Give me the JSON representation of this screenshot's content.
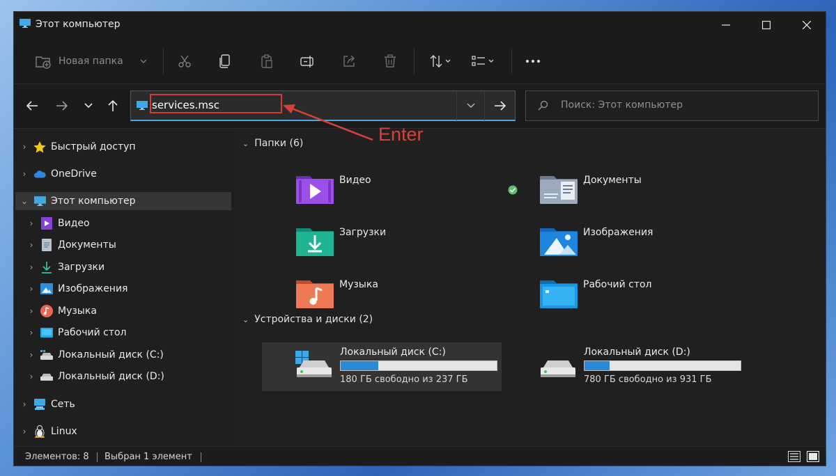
{
  "window": {
    "title": "Этот компьютер"
  },
  "toolbar": {
    "new_folder_label": "Новая папка"
  },
  "address": {
    "value": "services.msc",
    "annotation": "Enter"
  },
  "search": {
    "placeholder": "Поиск: Этот компьютер"
  },
  "sidebar": {
    "items": [
      {
        "label": "Быстрый доступ",
        "icon": "star-icon",
        "level": 0
      },
      {
        "label": "OneDrive",
        "icon": "cloud-icon",
        "level": 0
      },
      {
        "label": "Этот компьютер",
        "icon": "computer-icon",
        "level": 0,
        "expanded": true,
        "selected": true
      },
      {
        "label": "Видео",
        "icon": "video-icon",
        "level": 1
      },
      {
        "label": "Документы",
        "icon": "documents-icon",
        "level": 1
      },
      {
        "label": "Загрузки",
        "icon": "downloads-icon",
        "level": 1
      },
      {
        "label": "Изображения",
        "icon": "pictures-icon",
        "level": 1
      },
      {
        "label": "Музыка",
        "icon": "music-icon",
        "level": 1
      },
      {
        "label": "Рабочий стол",
        "icon": "desktop-icon",
        "level": 1
      },
      {
        "label": "Локальный диск (C:)",
        "icon": "drive-icon",
        "level": 1
      },
      {
        "label": "Локальный диск (D:)",
        "icon": "drive-icon",
        "level": 1
      },
      {
        "label": "Сеть",
        "icon": "network-icon",
        "level": 0
      },
      {
        "label": "Linux",
        "icon": "linux-icon",
        "level": 0
      }
    ]
  },
  "main": {
    "folders_header": "Папки (6)",
    "folders": [
      {
        "name": "Видео",
        "icon": "video-folder-icon"
      },
      {
        "name": "Документы",
        "icon": "documents-folder-icon",
        "synced": true
      },
      {
        "name": "Загрузки",
        "icon": "downloads-folder-icon"
      },
      {
        "name": "Изображения",
        "icon": "pictures-folder-icon"
      },
      {
        "name": "Музыка",
        "icon": "music-folder-icon"
      },
      {
        "name": "Рабочий стол",
        "icon": "desktop-folder-icon"
      }
    ],
    "drives_header": "Устройства и диски (2)",
    "drives": [
      {
        "name": "Локальный диск (C:)",
        "free": "180 ГБ свободно из 237 ГБ",
        "used_fraction": 0.24,
        "selected": true
      },
      {
        "name": "Локальный диск (D:)",
        "free": "780 ГБ свободно из 931 ГБ",
        "used_fraction": 0.16
      }
    ]
  },
  "status": {
    "count": "Элементов: 8",
    "selection": "Выбран 1 элемент"
  },
  "colors": {
    "accent": "#2a8ad7",
    "annotation": "#d8413a",
    "window_bg": "#202020"
  }
}
